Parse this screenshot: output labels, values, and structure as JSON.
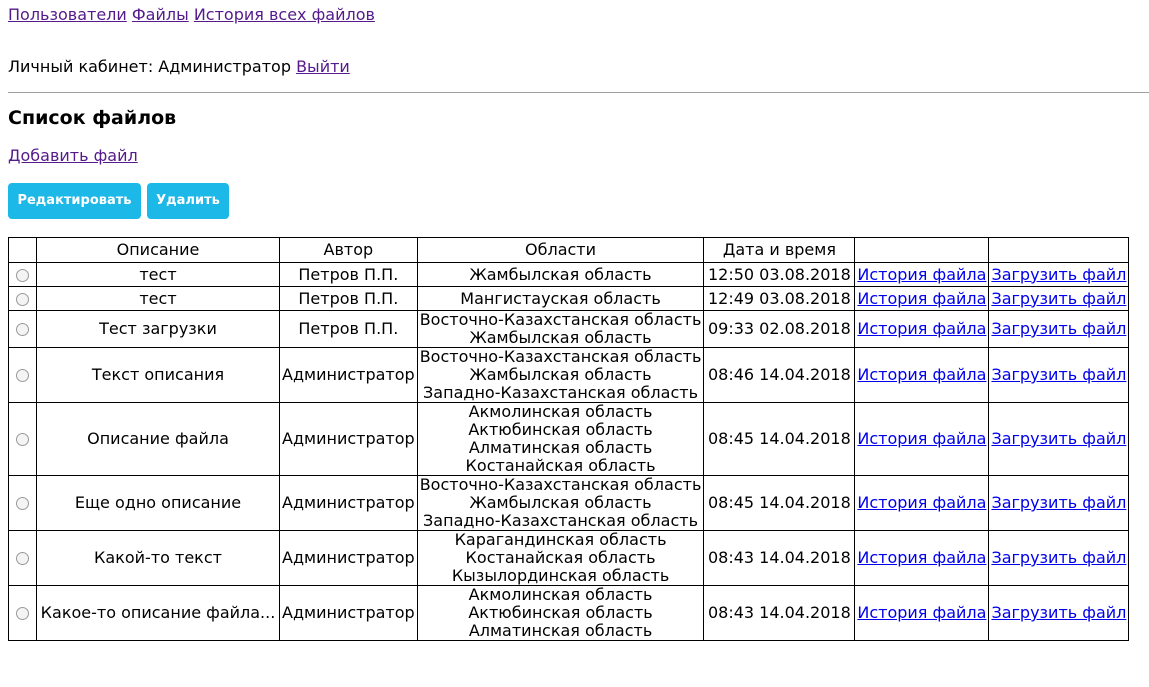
{
  "nav": {
    "users": "Пользователи",
    "files": "Файлы",
    "history_all": "История всех файлов"
  },
  "cabinet": {
    "label": "Личный кабинет: Администратор",
    "logout": "Выйти"
  },
  "page_title": "Список файлов",
  "add_file": "Добавить файл",
  "buttons": {
    "edit": "Редактировать",
    "delete": "Удалить"
  },
  "table": {
    "headers": [
      "",
      "Описание",
      "Автор",
      "Области",
      "Дата и время",
      "",
      ""
    ],
    "history_link": "История файла",
    "upload_link": "Загрузить файл",
    "rows": [
      {
        "description": "тест",
        "author": "Петров П.П.",
        "regions": [
          "Жамбылская область"
        ],
        "datetime": "12:50 03.08.2018"
      },
      {
        "description": "тест",
        "author": "Петров П.П.",
        "regions": [
          "Мангистауская область"
        ],
        "datetime": "12:49 03.08.2018"
      },
      {
        "description": "Тест загрузки",
        "author": "Петров П.П.",
        "regions": [
          "Восточно-Казахстанская область",
          "Жамбылская область"
        ],
        "datetime": "09:33 02.08.2018"
      },
      {
        "description": "Текст описания",
        "author": "Администратор",
        "regions": [
          "Восточно-Казахстанская область",
          "Жамбылская область",
          "Западно-Казахстанская область"
        ],
        "datetime": "08:46 14.04.2018"
      },
      {
        "description": "Описание файла",
        "author": "Администратор",
        "regions": [
          "Акмолинская область",
          "Актюбинская область",
          "Алматинская область",
          "Костанайская область"
        ],
        "datetime": "08:45 14.04.2018"
      },
      {
        "description": "Еще одно описание",
        "author": "Администратор",
        "regions": [
          "Восточно-Казахстанская область",
          "Жамбылская область",
          "Западно-Казахстанская область"
        ],
        "datetime": "08:45 14.04.2018"
      },
      {
        "description": "Какой-то текст",
        "author": "Администратор",
        "regions": [
          "Карагандинская область",
          "Костанайская область",
          "Кызылординская область"
        ],
        "datetime": "08:43 14.04.2018"
      },
      {
        "description": "Какое-то описание файла...",
        "author": "Администратор",
        "regions": [
          "Акмолинская область",
          "Актюбинская область",
          "Алматинская область"
        ],
        "datetime": "08:43 14.04.2018"
      }
    ]
  }
}
